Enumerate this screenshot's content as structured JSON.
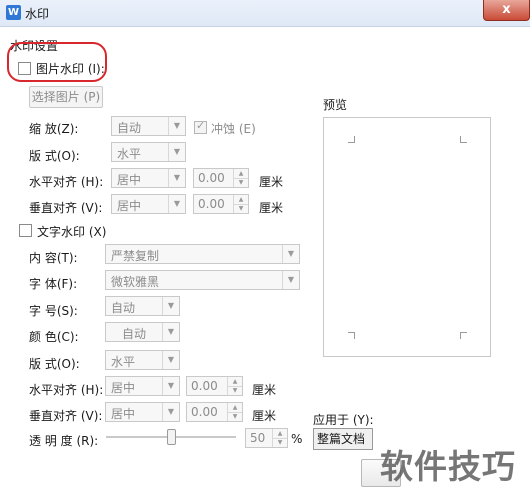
{
  "window": {
    "title": "水印",
    "close_glyph": "x",
    "app_icon_glyph": "W"
  },
  "watermark_settings": {
    "group_title": "水印设置"
  },
  "picture": {
    "checkbox_label": "图片水印 (I):",
    "select_button": "选择图片 (P)",
    "scale_label": "缩 放(Z):",
    "scale_value": "自动",
    "washout_label": "冲蚀 (E)",
    "layout_label": "版 式(O):",
    "layout_value": "水平",
    "halign_label": "水平对齐 (H):",
    "halign_value": "居中",
    "halign_offset": "0.00",
    "valign_label": "垂直对齐 (V):",
    "valign_value": "居中",
    "valign_offset": "0.00",
    "unit": "厘米"
  },
  "text": {
    "checkbox_label": "文字水印 (X)",
    "content_label": "内 容(T):",
    "content_value": "严禁复制",
    "font_label": "字 体(F):",
    "font_value": "微软雅黑",
    "size_label": "字 号(S):",
    "size_value": "自动",
    "color_label": "颜 色(C):",
    "color_value": "自动",
    "layout_label": "版 式(O):",
    "layout_value": "水平",
    "halign_label": "水平对齐 (H):",
    "halign_value": "居中",
    "halign_offset": "0.00",
    "valign_label": "垂直对齐 (V):",
    "valign_value": "居中",
    "valign_offset": "0.00",
    "unit": "厘米",
    "transparency_label": "透 明 度 (R):",
    "transparency_value": "50",
    "transparency_unit": "%"
  },
  "preview": {
    "label": "预览"
  },
  "apply": {
    "label": "应用于 (Y):",
    "value": "整篇文档"
  },
  "overlay": {
    "watermark_text": "软件技巧"
  },
  "colors": {
    "annotation": "#d9272e",
    "close_button": "#c94a37",
    "title_bar": "#dfe8f6"
  }
}
